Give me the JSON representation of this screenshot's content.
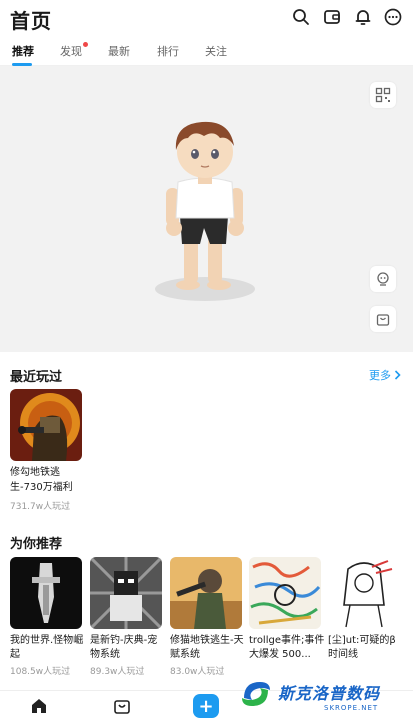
{
  "header": {
    "title": "首页"
  },
  "tabs": [
    {
      "label": "推荐",
      "active": true
    },
    {
      "label": "发现",
      "has_dot": true
    },
    {
      "label": "最新"
    },
    {
      "label": "排行"
    },
    {
      "label": "关注"
    }
  ],
  "header_icons": [
    "search-icon",
    "wallet-icon",
    "bell-icon",
    "more-icon"
  ],
  "stage_buttons": [
    "qr-scan-icon",
    "character-icon",
    "shop-bag-icon"
  ],
  "recent": {
    "title": "最近玩过",
    "more_label": "更多",
    "items": [
      {
        "name": "修勾地铁逃生-730万福利",
        "plays": "731.7w人玩过"
      }
    ]
  },
  "recommend": {
    "title": "为你推荐",
    "items": [
      {
        "name": "我的世界.怪物崛起",
        "plays": "108.5w人玩过"
      },
      {
        "name": "是新钓-庆典-宠物系统",
        "plays": "89.3w人玩过"
      },
      {
        "name": "修猫地铁逃生-天赋系统",
        "plays": "83.0w人玩过"
      },
      {
        "name": "trollge事件;事件大爆发 500...",
        "plays": ""
      },
      {
        "name": "[尘]ut:可疑的β时间线",
        "plays": ""
      }
    ]
  },
  "bottom_nav": [
    "home-icon",
    "shop-icon",
    "add-icon"
  ],
  "watermark": {
    "text": "斯克洛普数码",
    "sub": "SKROPE.NET"
  },
  "colors": {
    "accent": "#1d9bf0",
    "dot": "#f04848",
    "stage_bg": "#f2f2f2",
    "watermark": "#1a66c7"
  }
}
